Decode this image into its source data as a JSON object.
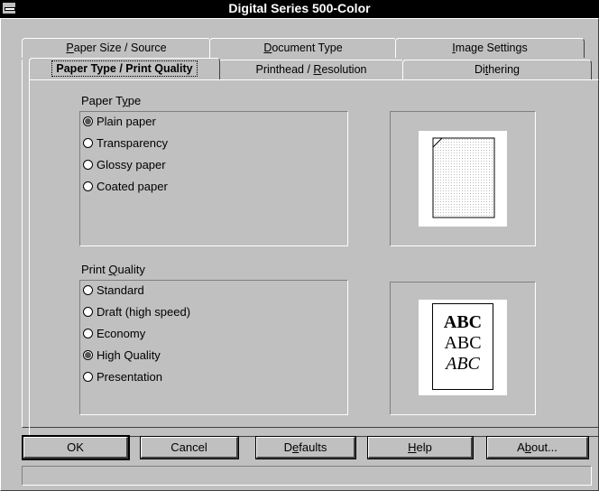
{
  "window": {
    "title": "Digital Series 500-Color"
  },
  "tabs_back": [
    {
      "label": "Paper Size / Source",
      "ul": "P",
      "rest": "aper Size / Source"
    },
    {
      "label": "Document Type",
      "ul": "D",
      "rest": "ocument Type"
    },
    {
      "label": "Image Settings",
      "ul": "I",
      "rest": "mage Settings"
    }
  ],
  "tabs_front": {
    "active_label": "Paper Type / Print Quality",
    "printhead": {
      "pre": "Printhead / ",
      "ul": "R",
      "rest": "esolution"
    },
    "dithering": {
      "pre": "Di",
      "ul": "t",
      "rest": "hering"
    }
  },
  "paper_type": {
    "label_pre": "Paper T",
    "label_ul": "y",
    "label_rest": "pe",
    "options": [
      {
        "label": "Plain paper",
        "selected": true
      },
      {
        "label": "Transparency",
        "selected": false
      },
      {
        "label": "Glossy paper",
        "selected": false
      },
      {
        "label": "Coated paper",
        "selected": false
      }
    ]
  },
  "print_quality": {
    "label_pre": "Print ",
    "label_ul": "Q",
    "label_rest": "uality",
    "options": [
      {
        "label": "Standard",
        "selected": false
      },
      {
        "label": "Draft (high speed)",
        "selected": false
      },
      {
        "label": "Economy",
        "selected": false
      },
      {
        "label": "High Quality",
        "selected": true
      },
      {
        "label": "Presentation",
        "selected": false
      }
    ],
    "preview_lines": [
      "ABC",
      "ABC",
      "ABC"
    ]
  },
  "buttons": {
    "ok": "OK",
    "cancel": "Cancel",
    "defaults": {
      "pre": "D",
      "ul": "e",
      "rest": "faults"
    },
    "help": {
      "pre": "",
      "ul": "H",
      "rest": "elp"
    },
    "about": {
      "pre": "A",
      "ul": "b",
      "rest": "out..."
    }
  },
  "status": {
    "text": ""
  }
}
